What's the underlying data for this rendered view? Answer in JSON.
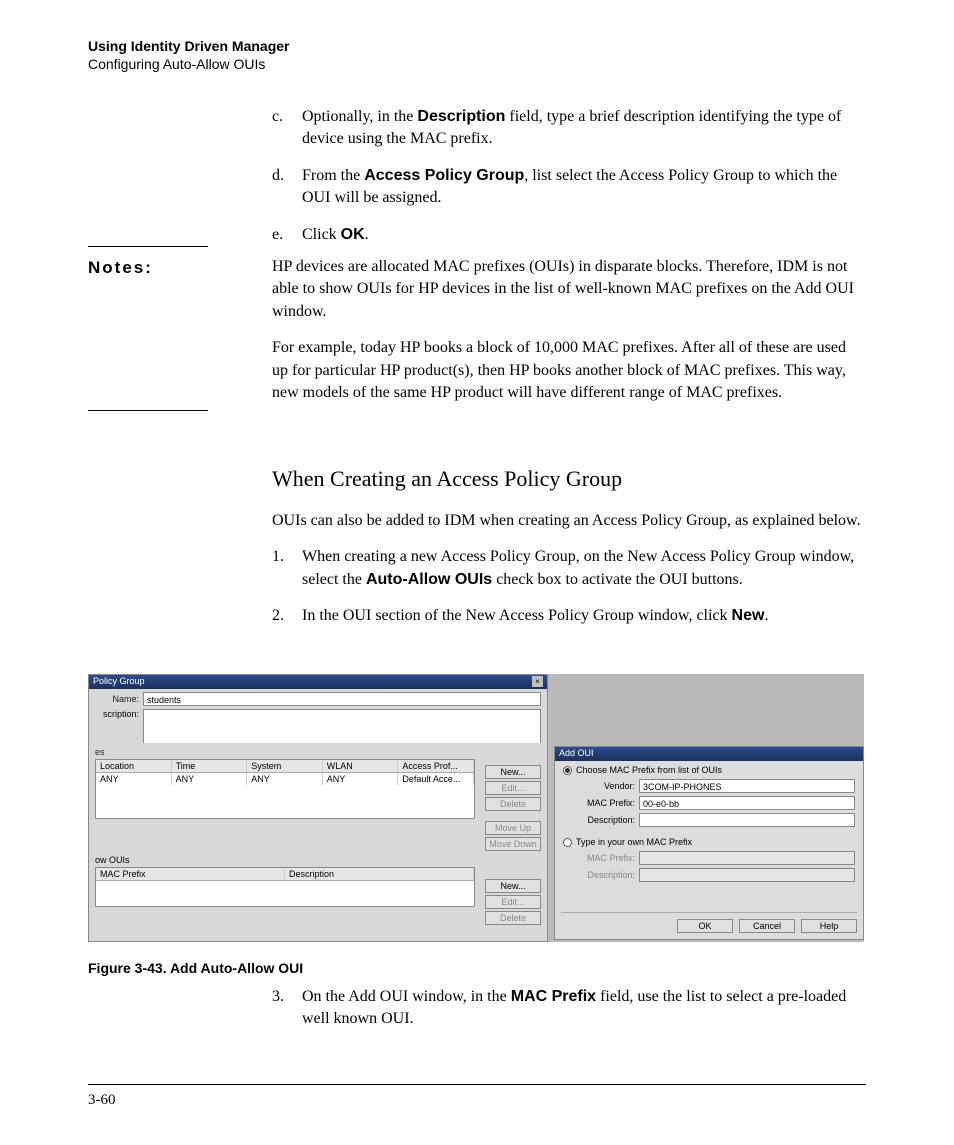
{
  "header": {
    "title": "Using Identity Driven Manager",
    "subtitle": "Configuring Auto-Allow OUIs"
  },
  "steps_alpha": {
    "c": {
      "marker": "c.",
      "pre": "Optionally, in the ",
      "bold": "Description",
      "post": " field, type a brief description identifying the type of device using the MAC prefix."
    },
    "d": {
      "marker": "d.",
      "pre": "From the ",
      "bold": "Access Policy Group",
      "post": ", list select the Access Policy Group to which the OUI will be assigned."
    },
    "e": {
      "marker": "e.",
      "pre": "Click ",
      "bold": "OK",
      "post": "."
    }
  },
  "notes_label": "Notes:",
  "notes_p1": "HP devices are allocated MAC prefixes (OUIs) in disparate blocks. Therefore, IDM is not able to show OUIs for HP devices in the list of well-known MAC prefixes on the Add OUI window.",
  "notes_p2": "For example, today HP books a block of 10,000 MAC prefixes. After all of these are used up for particular HP product(s), then HP books another block of MAC prefixes. This way, new models of the same HP product will have different range of MAC prefixes.",
  "section_heading": "When Creating an Access Policy Group",
  "section_intro": "OUIs can also be added to IDM when creating an Access Policy Group, as explained below.",
  "steps_num": {
    "s1": {
      "marker": "1.",
      "pre": "When creating a new Access Policy Group, on the New Access Policy Group window, select the ",
      "bold": "Auto-Allow OUIs",
      "post": " check box to activate the OUI buttons."
    },
    "s2": {
      "marker": "2.",
      "pre": "In the OUI section of the New Access Policy Group window, click ",
      "bold": "New",
      "post": "."
    },
    "s3": {
      "marker": "3.",
      "pre": "On the Add OUI window, in the ",
      "bold": "MAC Prefix",
      "post": " field, use the list to select a pre-loaded well known OUI."
    }
  },
  "figure": {
    "left": {
      "title": "Policy Group",
      "name_label": "Name:",
      "name_value": "students",
      "desc_label": "scription:",
      "rules_label": "es",
      "columns": {
        "c1": "Location",
        "c2": "Time",
        "c3": "System",
        "c4": "WLAN",
        "c5": "Access Prof..."
      },
      "row": {
        "c1": "ANY",
        "c2": "ANY",
        "c3": "ANY",
        "c4": "ANY",
        "c5": "Default Acce..."
      },
      "btns": {
        "new": "New...",
        "edit": "Edit...",
        "delete": "Delete",
        "moveup": "Move Up",
        "movedown": "Move Down"
      },
      "ouis_label": "ow OUIs",
      "oui_columns": {
        "c1": "MAC Prefix",
        "c2": "Description"
      },
      "oui_btns": {
        "new": "New...",
        "edit": "Edit...",
        "delete": "Delete"
      }
    },
    "right": {
      "title": "Add OUI",
      "radio1": "Choose MAC Prefix from list of OUIs",
      "vendor_label": "Vendor:",
      "vendor_value": "3COM-IP-PHONES",
      "macprefix_label": "MAC Prefix:",
      "macprefix_value": "00-e0-bb",
      "desc_label": "Description:",
      "radio2": "Type in your own MAC Prefix",
      "mac2_label": "MAC Prefix:",
      "desc2_label": "Description:",
      "ok": "OK",
      "cancel": "Cancel",
      "help": "Help"
    }
  },
  "caption": "Figure 3-43. Add Auto-Allow OUI",
  "page_number": "3-60"
}
